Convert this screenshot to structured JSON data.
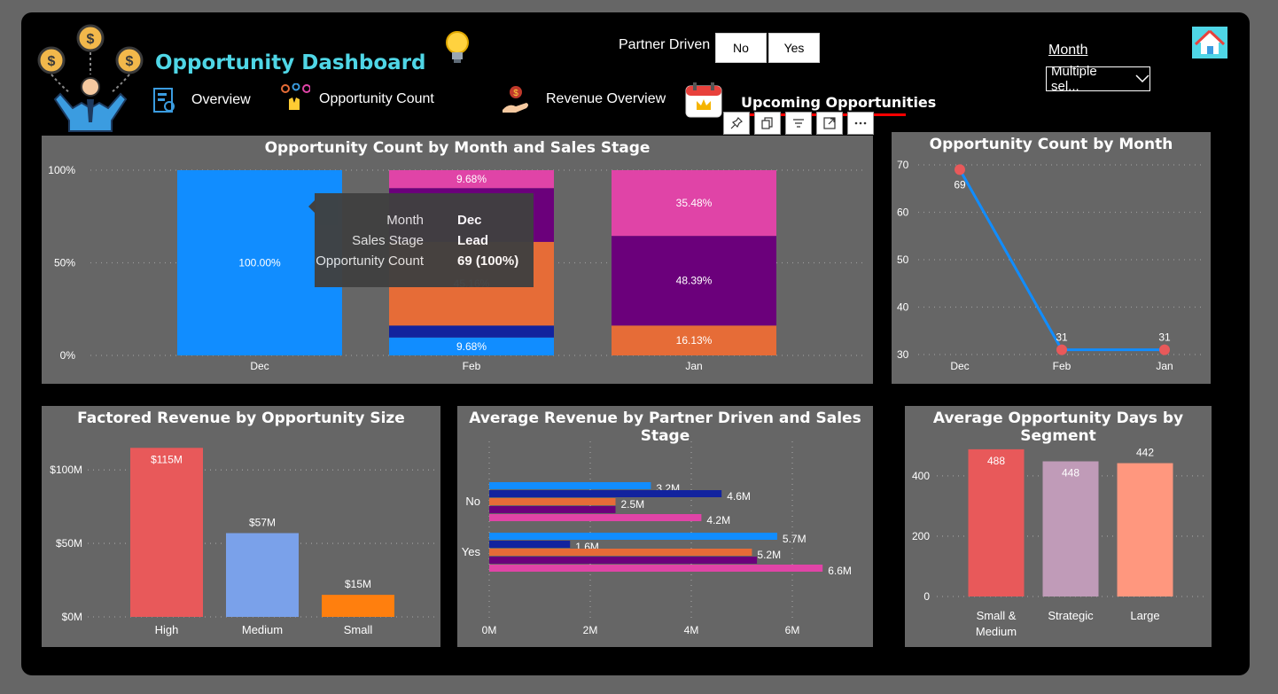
{
  "header": {
    "title": "Opportunity Dashboard",
    "nav": [
      {
        "label": "Overview",
        "icon": "report-icon"
      },
      {
        "label": "Opportunity Count",
        "icon": "keys-hand-icon"
      },
      {
        "label": "Revenue Overview",
        "icon": "money-hand-icon"
      },
      {
        "label": "Upcoming Opportunities",
        "icon": "calendar-icon"
      }
    ],
    "partner_driven": {
      "label": "Partner Driven",
      "options": [
        "No",
        "Yes"
      ]
    },
    "month_filter": {
      "label": "Month",
      "value": "Multiple sel..."
    }
  },
  "tooltip": {
    "rows": [
      {
        "key": "Month",
        "value": "Dec"
      },
      {
        "key": "Sales Stage",
        "value": "Lead"
      },
      {
        "key": "Opportunity Count",
        "value": "69 (100%)"
      }
    ]
  },
  "colors": {
    "lead": "#118dff",
    "qualify": "#12239e",
    "solution": "#e66c37",
    "proposal": "#6b007b",
    "finalize": "#e044a7",
    "line": "#118dff",
    "marker": "#e8595a"
  },
  "chart_data": [
    {
      "type": "bar",
      "stacked": "100%",
      "title": "Opportunity Count by Month and Sales Stage",
      "categories": [
        "Dec",
        "Feb",
        "Jan"
      ],
      "yticks": [
        "0%",
        "50%",
        "100%"
      ],
      "series": [
        {
          "values": [
            100.0,
            9.68,
            0
          ],
          "labels": [
            "100.00%",
            "9.68%",
            ""
          ]
        },
        {
          "values": [
            0,
            6.45,
            0
          ],
          "labels": [
            "",
            "",
            ""
          ]
        },
        {
          "values": [
            0,
            45.16,
            16.13
          ],
          "labels": [
            "",
            "45.16%",
            "16.13%"
          ]
        },
        {
          "values": [
            0,
            29.03,
            48.39
          ],
          "labels": [
            "",
            "",
            "48.39%"
          ]
        },
        {
          "values": [
            0,
            9.68,
            35.48
          ],
          "labels": [
            "",
            "9.68%",
            "35.48%"
          ]
        }
      ]
    },
    {
      "type": "line",
      "title": "Opportunity Count by Month",
      "x": [
        "Dec",
        "Feb",
        "Jan"
      ],
      "y": [
        69,
        31,
        31
      ],
      "yticks": [
        30,
        40,
        50,
        60,
        70
      ],
      "ylim": [
        30,
        70
      ]
    },
    {
      "type": "bar",
      "title": "Factored Revenue by Opportunity Size",
      "categories": [
        "High",
        "Medium",
        "Small"
      ],
      "values": [
        115,
        57,
        15
      ],
      "labels": [
        "$115M",
        "$57M",
        "$15M"
      ],
      "colors": [
        "#e8595a",
        "#7aa1ea",
        "#ff7f0e"
      ],
      "yticks": [
        "$0M",
        "$50M",
        "$100M"
      ],
      "ylim": [
        0,
        120
      ]
    },
    {
      "type": "bar",
      "orientation": "horizontal",
      "title": "Average Revenue by Partner Driven and Sales Stage",
      "categories": [
        "No",
        "Yes"
      ],
      "xticks": [
        "0M",
        "2M",
        "4M",
        "6M"
      ],
      "xlim": [
        0,
        6.9
      ],
      "series": [
        {
          "values": [
            3.2,
            5.7
          ],
          "labels": [
            "3.2M",
            "5.7M"
          ]
        },
        {
          "values": [
            4.6,
            1.6
          ],
          "labels": [
            "4.6M",
            "1.6M"
          ]
        },
        {
          "values": [
            2.5,
            5.2
          ],
          "labels": [
            "2.5M",
            "5.2M"
          ]
        },
        {
          "values": [
            2.5,
            5.3
          ],
          "labels": [
            "",
            ""
          ]
        },
        {
          "values": [
            4.2,
            6.6
          ],
          "labels": [
            "4.2M",
            "6.6M"
          ]
        }
      ]
    },
    {
      "type": "bar",
      "title": "Average Opportunity Days by Segment",
      "categories": [
        "Small & Medium",
        "Strategic",
        "Large"
      ],
      "values": [
        488,
        448,
        442
      ],
      "labels": [
        "488",
        "448",
        "442"
      ],
      "colors": [
        "#e8595a",
        "#c09bb8",
        "#ff977e"
      ],
      "yticks": [
        0,
        200,
        400
      ],
      "ylim": [
        0,
        520
      ]
    }
  ]
}
